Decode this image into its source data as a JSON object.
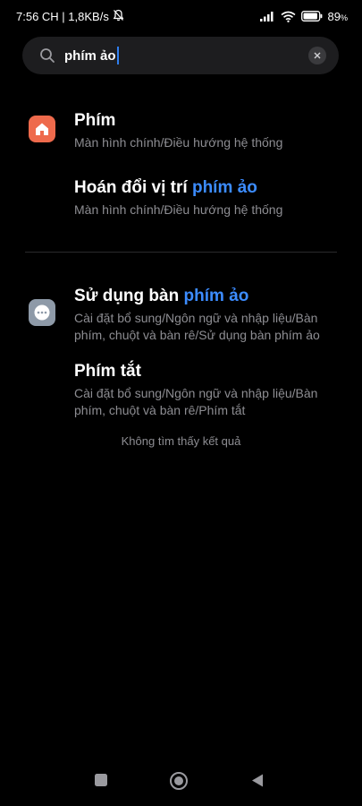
{
  "status_bar": {
    "time_info": "7:56 CH | 1,8KB/s",
    "battery_percent": "89",
    "percent_sign": "%",
    "icons": [
      "mute-bell-icon",
      "signal-icon",
      "wifi-icon",
      "battery-icon"
    ]
  },
  "search": {
    "query": "phím ảo",
    "icon": "search-icon",
    "clear_icon": "close-icon"
  },
  "results": [
    {
      "icon": "home-icon",
      "icon_color": "#ee6a4c",
      "title_plain": "Phím",
      "title_highlight": "",
      "path": "Màn hình chính/Điều hướng hệ thống"
    },
    {
      "title_plain": "Hoán đổi vị trí",
      "title_highlight": "phím ảo",
      "path": "Màn hình chính/Điều hướng hệ thống"
    },
    {
      "icon": "more-dots-icon",
      "icon_color": "#8e9aa8",
      "title_plain": "Sử dụng bàn",
      "title_highlight": "phím ảo",
      "path": "Cài đặt bổ sung/Ngôn ngữ và nhập liệu/Bàn phím, chuột và bàn rê/Sử dụng bàn phím ảo"
    },
    {
      "title_plain": "Phím tắt",
      "title_highlight": "",
      "path": "Cài đặt bổ sung/Ngôn ngữ và nhập liệu/Bàn phím, chuột và bàn rê/Phím tắt"
    }
  ],
  "no_result_text": "Không tìm thấy kết quả",
  "nav_bar": {
    "icons": [
      "recent-apps-icon",
      "home-nav-icon",
      "back-icon"
    ]
  },
  "colors": {
    "highlight": "#3c8cff",
    "background": "#000000",
    "secondary_text": "#8d8d92"
  }
}
